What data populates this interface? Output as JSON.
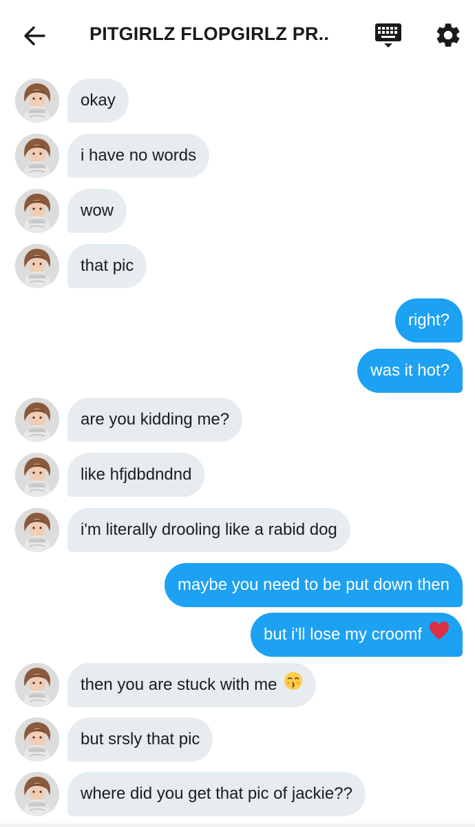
{
  "header": {
    "title": "PITGIRLZ FLOPGIRLZ PR...",
    "back_icon": "arrow-left-icon",
    "keyboard_icon": "keyboard-icon",
    "settings_icon": "gear-icon"
  },
  "colors": {
    "incoming_bubble": "#e6ecf0",
    "outgoing_bubble": "#1da1f2",
    "outgoing_text": "#ffffff"
  },
  "messages": [
    {
      "direction": "in",
      "text": "okay"
    },
    {
      "direction": "in",
      "text": "i have no words"
    },
    {
      "direction": "in",
      "text": "wow"
    },
    {
      "direction": "in",
      "text": "that pic"
    },
    {
      "direction": "out",
      "text": "right?"
    },
    {
      "direction": "out",
      "text": "was it hot?"
    },
    {
      "direction": "in",
      "text": "are you kidding me?"
    },
    {
      "direction": "in",
      "text": "like hfjdbdndnd"
    },
    {
      "direction": "in",
      "text": "i'm literally drooling like a rabid dog"
    },
    {
      "direction": "out",
      "text": "maybe you need to be put down then"
    },
    {
      "direction": "out",
      "text": "but i'll lose my croomf",
      "emoji": "red-heart-emoji"
    },
    {
      "direction": "in",
      "text": "then you are stuck with me",
      "emoji": "kissing-face-closed-eyes-emoji"
    },
    {
      "direction": "in",
      "text": "but srsly that pic"
    },
    {
      "direction": "in",
      "text": "where did you get that pic of jackie??"
    }
  ]
}
